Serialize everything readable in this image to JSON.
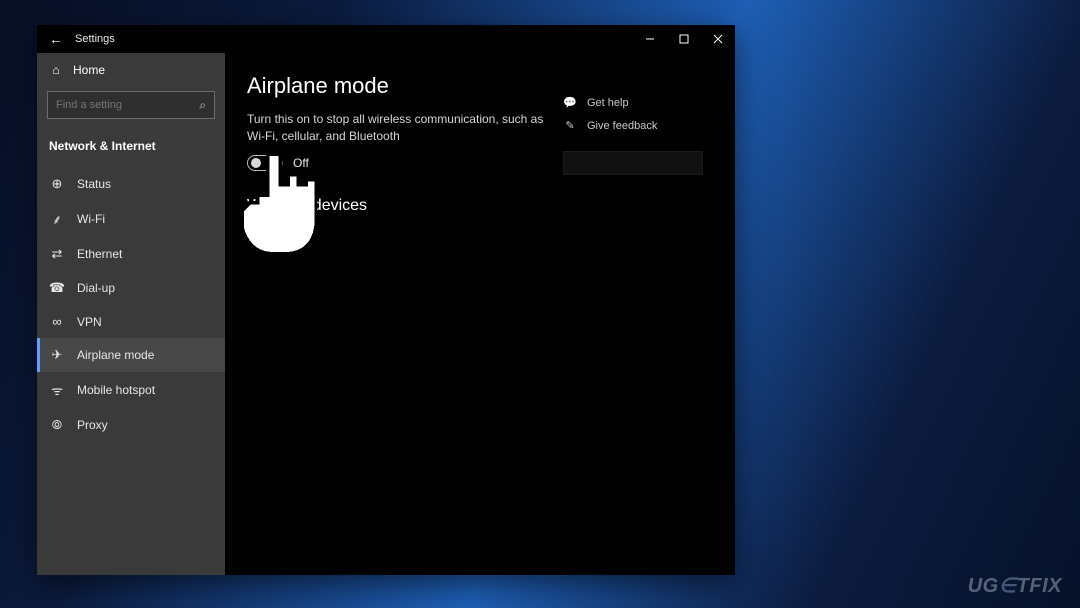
{
  "window": {
    "title": "Settings"
  },
  "sidebar": {
    "home_label": "Home",
    "search_placeholder": "Find a setting",
    "section": "Network & Internet",
    "items": [
      {
        "icon": "status-icon",
        "glyph": "⊕",
        "label": "Status",
        "selected": false
      },
      {
        "icon": "wifi-icon",
        "glyph": "⸙",
        "label": "Wi-Fi",
        "selected": false
      },
      {
        "icon": "ethernet-icon",
        "glyph": "⇄",
        "label": "Ethernet",
        "selected": false
      },
      {
        "icon": "dialup-icon",
        "glyph": "☎",
        "label": "Dial-up",
        "selected": false
      },
      {
        "icon": "vpn-icon",
        "glyph": "∞",
        "label": "VPN",
        "selected": false
      },
      {
        "icon": "airplane-icon",
        "glyph": "✈",
        "label": "Airplane mode",
        "selected": true
      },
      {
        "icon": "hotspot-icon",
        "glyph": "ᯤ",
        "label": "Mobile hotspot",
        "selected": false
      },
      {
        "icon": "proxy-icon",
        "glyph": "⦾",
        "label": "Proxy",
        "selected": false
      }
    ]
  },
  "page": {
    "title": "Airplane mode",
    "description": "Turn this on to stop all wireless communication, such as Wi-Fi, cellular, and Bluetooth",
    "toggle_state": "Off",
    "section2_prefix": "W",
    "section2_suffix": "less devices"
  },
  "right": {
    "help": "Get help",
    "feedback": "Give feedback"
  },
  "watermark": {
    "pre": "UG",
    "mid": "∈",
    "post": "TFIX"
  }
}
